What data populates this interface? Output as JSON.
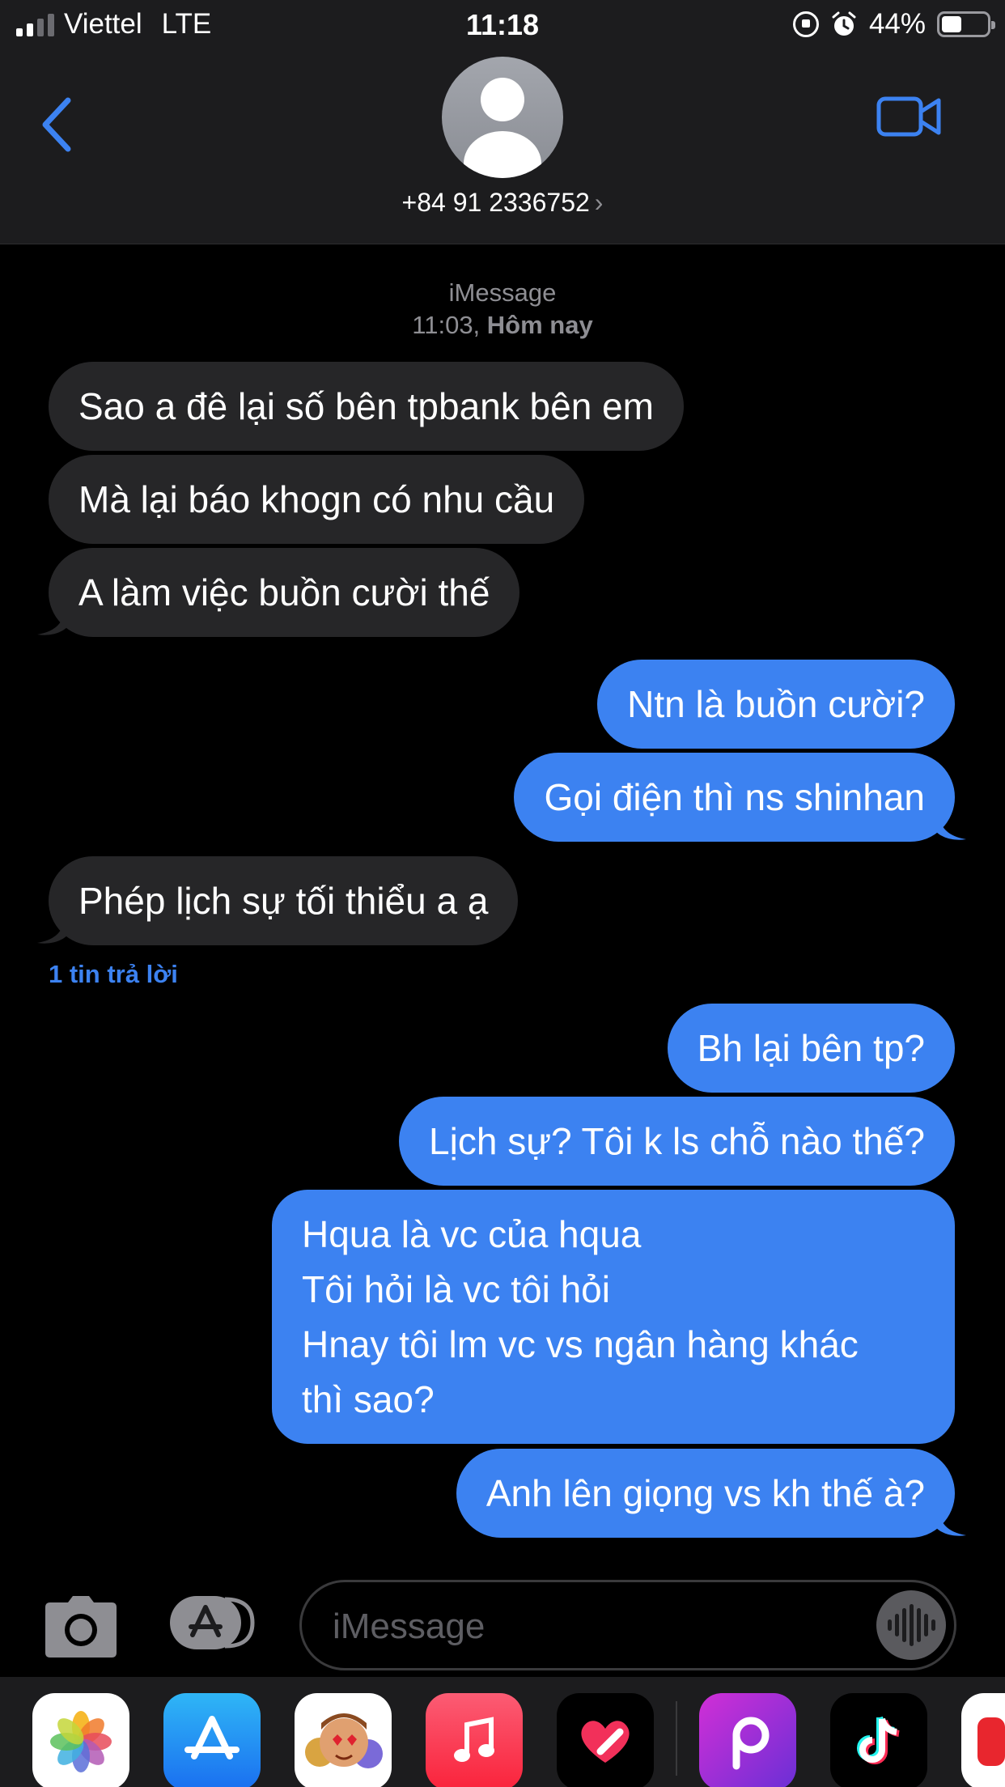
{
  "status_bar": {
    "carrier": "Viettel",
    "network": "LTE",
    "time": "11:18",
    "battery_percent": "44%",
    "battery_level": 0.44
  },
  "header": {
    "contact": "+84 91 2336752",
    "chevron": "›"
  },
  "conversation": {
    "service": "iMessage",
    "time": "11:03,",
    "day": "Hôm nay",
    "messages": [
      {
        "dir": "in",
        "text": "Sao a đê lại số bên tpbank bên em"
      },
      {
        "dir": "in",
        "text": "Mà lại báo khogn có nhu cầu"
      },
      {
        "dir": "in",
        "text": "A làm việc buồn cười thế"
      },
      {
        "dir": "out",
        "text": "Ntn là buồn cười?"
      },
      {
        "dir": "out",
        "text": "Gọi điện thì ns shinhan"
      },
      {
        "dir": "in",
        "text": "Phép lịch sự tối thiểu a ạ"
      },
      {
        "dir": "out",
        "text": "Bh lại bên tp?"
      },
      {
        "dir": "out",
        "text": "Lịch sự? Tôi k ls chỗ nào thế?"
      },
      {
        "dir": "out",
        "lines": [
          "Hqua là vc của hqua",
          "Tôi hỏi là vc tôi hỏi",
          "Hnay tôi lm vc vs ngân hàng khác",
          "thì sao?"
        ]
      },
      {
        "dir": "out",
        "text": "Anh lên giọng vs kh thế à?"
      }
    ],
    "reply_count_label": "1 tin trả lời"
  },
  "composer": {
    "placeholder": "iMessage"
  },
  "colors": {
    "accent": "#3c82f1",
    "incoming_bubble": "#262628",
    "background": "#000000",
    "bar": "#1c1c1e"
  },
  "icons": {
    "back": "chevron-left-icon",
    "video": "video-camera-icon",
    "camera": "camera-icon",
    "apps": "app-store-icon",
    "audio": "waveform-icon"
  },
  "drawer_apps": [
    "Photos",
    "App Store",
    "Memoji",
    "Music",
    "Digital Touch",
    "Picsart",
    "TikTok"
  ]
}
